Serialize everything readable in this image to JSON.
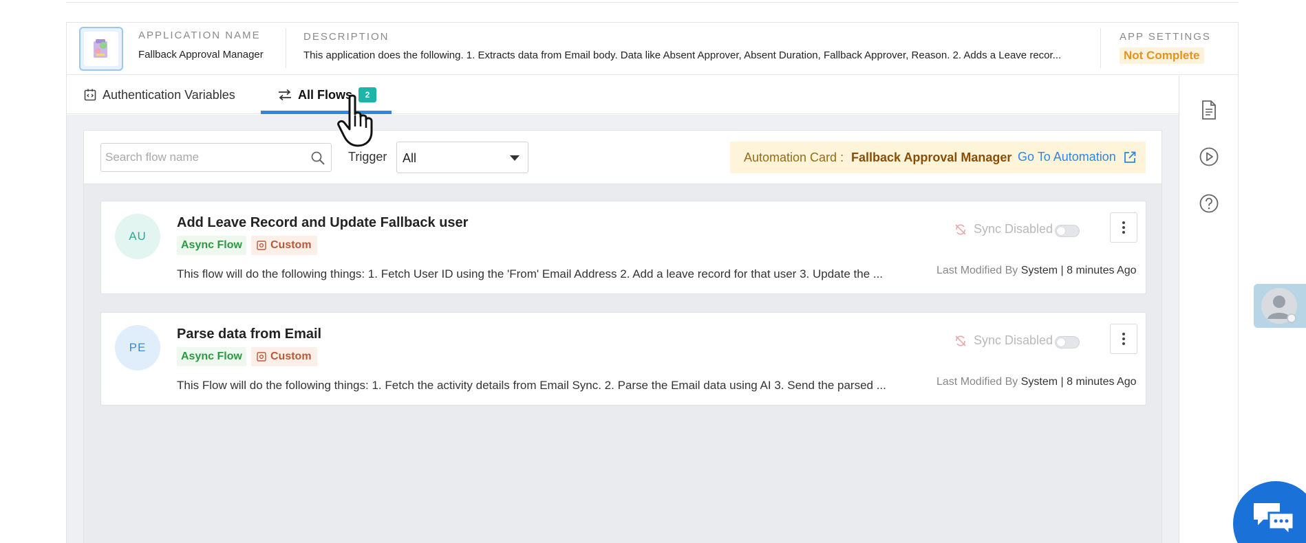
{
  "header": {
    "app_name_label": "APPLICATION NAME",
    "app_name": "Fallback Approval Manager",
    "description_label": "DESCRIPTION",
    "description": "This application does the following. 1. Extracts data from Email body. Data like Absent Approver, Absent Duration, Fallback Approver, Reason. 2. Adds a Leave recor...",
    "settings_label": "APP SETTINGS",
    "settings_status": "Not Complete"
  },
  "tabs": [
    {
      "label": "Authentication Variables",
      "icon": "auth-variables-icon"
    },
    {
      "label": "All Flows",
      "icon": "flows-arrows-icon",
      "badge": "2",
      "active": true
    }
  ],
  "toolbar": {
    "search_placeholder": "Search flow name",
    "search_value": "",
    "trigger_label": "Trigger",
    "trigger_value": "All",
    "automation_label": "Automation Card :",
    "automation_name": "Fallback Approval Manager",
    "automation_link": "Go To Automation"
  },
  "flows": [
    {
      "initials": "AU",
      "title": "Add Leave Record and Update Fallback user",
      "type_tag": "Async Flow",
      "custom_tag": "Custom",
      "description": "This flow will do the following things: 1. Fetch User ID using the 'From' Email Address 2. Add a leave record for that user 3. Update the ...",
      "sync_status": "Sync Disabled",
      "modified_label": "Last Modified By",
      "modified_by": "System | 8 minutes Ago",
      "avatar_bg": "#e3f5f1",
      "avatar_fg": "#2ca892"
    },
    {
      "initials": "PE",
      "title": "Parse data from Email",
      "type_tag": "Async Flow",
      "custom_tag": "Custom",
      "description": "This Flow will do the following things: 1. Fetch the activity details from Email Sync. 2. Parse the Email data using AI 3. Send the parsed ...",
      "sync_status": "Sync Disabled",
      "modified_label": "Last Modified By",
      "modified_by": "System | 8 minutes Ago",
      "avatar_bg": "#e0eefb",
      "avatar_fg": "#3a8ad8"
    }
  ],
  "rail_icons": [
    "document-icon",
    "play-circle-icon",
    "help-circle-icon"
  ],
  "colors": {
    "accent": "#2f86e0",
    "badge": "#1cb5a7",
    "warning": "#e2941c",
    "chat": "#1a72d8"
  }
}
